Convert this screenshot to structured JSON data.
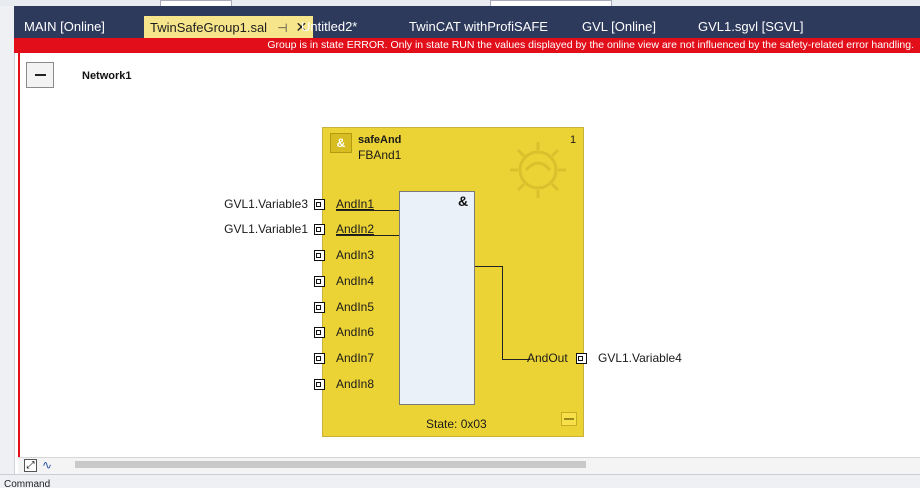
{
  "tabs": [
    {
      "label": "MAIN [Online]"
    },
    {
      "label": "TwinSafeGroup1.sal",
      "active": true
    },
    {
      "label": "Untitled2*"
    },
    {
      "label": "TwinCAT withProfiSAFE"
    },
    {
      "label": "GVL [Online]"
    },
    {
      "label": "GVL1.sgvl [SGVL]"
    }
  ],
  "banner": {
    "text": "Group is in state ERROR. Only in state RUN the values displayed by the online view are not influenced by the safety-related error handling."
  },
  "network": {
    "title": "Network1"
  },
  "fb": {
    "type": "safeAnd",
    "instance": "FBAnd1",
    "number": "1",
    "operator": "&",
    "state": "State: 0x03",
    "inputs": [
      "AndIn1",
      "AndIn2",
      "AndIn3",
      "AndIn4",
      "AndIn5",
      "AndIn6",
      "AndIn7",
      "AndIn8"
    ],
    "output": "AndOut"
  },
  "vars": {
    "in1": "GVL1.Variable3",
    "in2": "GVL1.Variable1",
    "out": "GVL1.Variable4"
  },
  "bottom": {
    "command": "Command"
  },
  "colors": {
    "tab_strip": "#2d3a5c",
    "banner": "#e20f1a",
    "fb_body": "#ecd335",
    "active_tab": "#f6e58a"
  },
  "icons": [
    "pin-icon",
    "close-icon",
    "collapse-icon",
    "and-icon",
    "output-pin-icon"
  ]
}
